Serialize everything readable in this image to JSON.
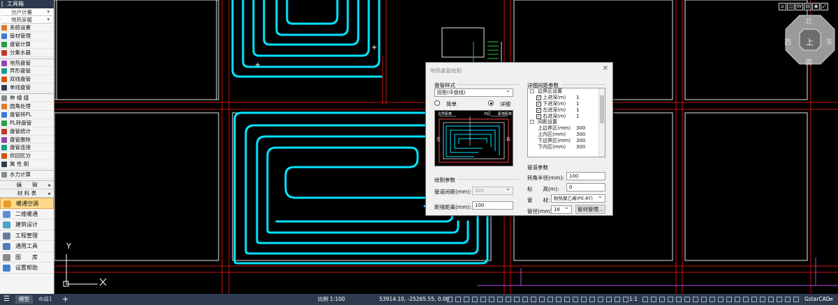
{
  "toolbox": {
    "title": "工具箱",
    "dropdowns": [
      "分户计量",
      "地热采暖"
    ],
    "items_a": [
      "系统设置",
      "管材管理",
      "盘管计算",
      "分集水器"
    ],
    "items_b": [
      "地热盘管",
      "异形盘管",
      "双线盘管",
      "单线盘管"
    ],
    "items_c": [
      "伸 缩 缝",
      "圆角处理",
      "盘管转PL",
      "PL转盘管",
      "盘管统计",
      "盘管删除",
      "盘管连接",
      "供回区分",
      "属 性 刷"
    ],
    "items_d": [
      "水力计算"
    ],
    "groups": [
      "编　　辑",
      "材 料 表"
    ],
    "modules": [
      "暖通空调",
      "二维暖通",
      "建筑设计",
      "工程管理",
      "通用工具",
      "图　　库",
      "设置帮助"
    ],
    "active_module": "暖通空调",
    "colors": {
      "panel_bg": "#f4f4f4",
      "active_bg": "#ffd98a",
      "title_bg": "#2d3a4d"
    }
  },
  "canvas": {
    "axis_y": "Y",
    "axis_x": "X",
    "compass": {
      "north": "北",
      "south": "南",
      "east": "东",
      "west": "西",
      "top": "上",
      "view_buttons": [
        "W"
      ]
    },
    "colors": {
      "pipe": "#00e5ff",
      "wall": "#ffffff",
      "grid_red": "#cc1010",
      "bg": "#000000"
    }
  },
  "dialog": {
    "title": "地热盘管绘制",
    "coil_style_label": "盘管样式",
    "coil_style_value": "回型(中盘线)",
    "mode_simple": "简单",
    "mode_detail": "详细",
    "mode_selected": "详细",
    "preview": {
      "label_wall_dist": "距墙距离",
      "label_pitch": "内区",
      "label_gap": "边界距离",
      "label_left": "左",
      "label_right": "右"
    },
    "draw_params_label": "绘制参数",
    "pipe_spacing_label": "管道间距(mm):",
    "pipe_spacing_value": "300",
    "wall_dist_label": "距墙距离(mm):",
    "wall_dist_value": "100",
    "detail_params_label": "详细间距参数",
    "tree": [
      {
        "type": "group",
        "label": "边界区设置"
      },
      {
        "type": "item",
        "checked": true,
        "key": "上进深(m)",
        "value": "1"
      },
      {
        "type": "item",
        "checked": true,
        "key": "下进深(m)",
        "value": "1"
      },
      {
        "type": "item",
        "checked": true,
        "key": "左进深(m)",
        "value": "1"
      },
      {
        "type": "item",
        "checked": true,
        "key": "右进深(m)",
        "value": "1"
      },
      {
        "type": "group",
        "label": "间距设置"
      },
      {
        "type": "plain",
        "key": "上边界区(mm)",
        "value": "300"
      },
      {
        "type": "plain",
        "key": "上内区(mm)",
        "value": "300"
      },
      {
        "type": "plain",
        "key": "下边界区(mm)",
        "value": "300"
      },
      {
        "type": "plain",
        "key": "下内区(mm)",
        "value": "300"
      }
    ],
    "pipe_params_label": "管道参数",
    "bend_radius_label": "转角半径(mm):",
    "bend_radius_value": "100",
    "elevation_label": "标　　高(m):",
    "elevation_value": "0",
    "material_label": "管　　材:",
    "material_value": "耐热聚乙烯(PE-RT)",
    "diameter_label": "管径(mm):",
    "diameter_value": "16",
    "material_mgmt_button": "管材管理..."
  },
  "statusbar": {
    "tab_model": "模型",
    "tab_layout": "布局1",
    "add_tab": "+",
    "scale": "比例 1:100",
    "coords": "53914.10, -25265.55, 0.00",
    "annot_scale": "1:1",
    "app_name": "GstarCAD",
    "colors": {
      "bg": "#2e3b4e"
    }
  }
}
